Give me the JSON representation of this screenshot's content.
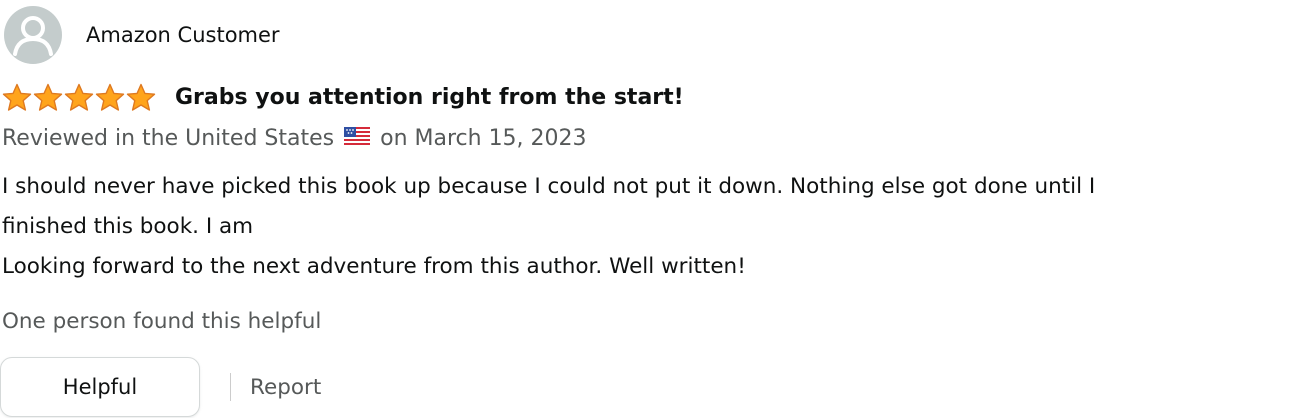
{
  "profile": {
    "name": "Amazon Customer",
    "avatar_icon": "default-user-avatar-icon"
  },
  "rating": {
    "stars": 5,
    "max": 5,
    "color": "#ffa41c",
    "outline_color": "#de7921"
  },
  "review": {
    "title": "Grabs you attention right from the start!",
    "reviewed_prefix": "Reviewed in the United States",
    "flag_icon": "us-flag-icon",
    "date_text": "on March 15, 2023",
    "body_lines": [
      "I should never have picked this book up because I could not put it down. Nothing else got done until I",
      "finished this book. I am",
      "Looking forward to the next adventure from this author. Well written!"
    ]
  },
  "helpful": {
    "count_text": "One person found this helpful",
    "button_label": "Helpful",
    "report_label": "Report"
  },
  "colors": {
    "text": "#0f1111",
    "secondary_text": "#565959",
    "avatar_bg": "#c4cccc",
    "button_border": "#d5d9d9"
  }
}
